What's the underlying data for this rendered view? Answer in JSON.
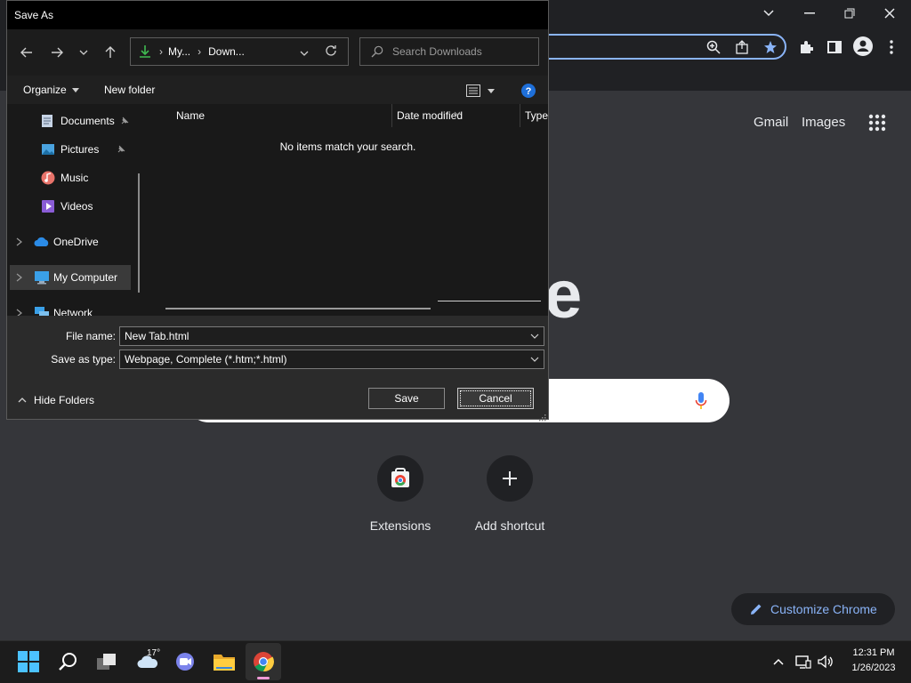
{
  "browser": {
    "links": {
      "gmail": "Gmail",
      "images": "Images"
    },
    "logo_partial": "e",
    "shortcuts": [
      {
        "label": "Extensions",
        "icon": "chrome-web-store-icon"
      },
      {
        "label": "Add shortcut",
        "icon": "plus-icon"
      }
    ],
    "customize_label": "Customize Chrome",
    "accent_color": "#8ab4f8"
  },
  "dialog": {
    "title": "Save As",
    "breadcrumb": [
      "My...",
      "Down..."
    ],
    "search_placeholder": "Search Downloads",
    "organize_label": "Organize",
    "new_folder_label": "New folder",
    "nav_items": [
      {
        "label": "Documents",
        "icon": "documents-icon",
        "pinned": true
      },
      {
        "label": "Pictures",
        "icon": "pictures-icon",
        "pinned": true
      },
      {
        "label": "Music",
        "icon": "music-icon"
      },
      {
        "label": "Videos",
        "icon": "videos-icon"
      },
      {
        "label": "OneDrive",
        "icon": "onedrive-icon"
      },
      {
        "label": "My Computer",
        "icon": "computer-icon",
        "selected": true
      },
      {
        "label": "Network",
        "icon": "network-icon"
      }
    ],
    "columns": [
      "Name",
      "Date modified",
      "Type"
    ],
    "empty_message": "No items match your search.",
    "file_name_label": "File name:",
    "file_name_value": "New Tab.html",
    "save_type_label": "Save as type:",
    "save_type_value": "Webpage, Complete (*.htm;*.html)",
    "hide_folders_label": "Hide Folders",
    "save_label": "Save",
    "cancel_label": "Cancel"
  },
  "taskbar": {
    "weather_temp": "17°",
    "time": "12:31 PM",
    "date": "1/26/2023"
  }
}
